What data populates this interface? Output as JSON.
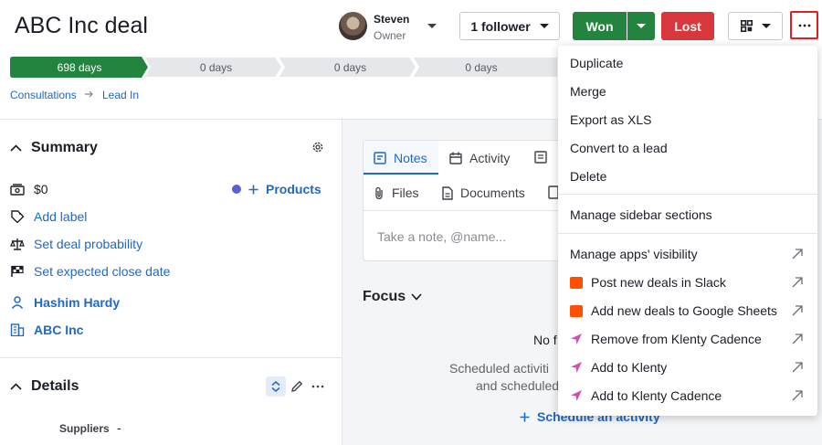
{
  "deal": {
    "title": "ABC Inc deal"
  },
  "owner": {
    "name": "Steven",
    "role": "Owner"
  },
  "header": {
    "follower_label": "1 follower",
    "won_label": "Won",
    "lost_label": "Lost"
  },
  "pipeline": {
    "stages": [
      {
        "label": "698 days",
        "active": true
      },
      {
        "label": "0 days",
        "active": false
      },
      {
        "label": "0 days",
        "active": false
      },
      {
        "label": "0 days",
        "active": false
      }
    ],
    "breadcrumb": [
      "Consultations",
      "Lead In"
    ]
  },
  "summary": {
    "title": "Summary",
    "value": "$0",
    "products_label": "Products",
    "rows": [
      "Add label",
      "Set deal probability",
      "Set expected close date"
    ],
    "person": "Hashim Hardy",
    "organization": "ABC Inc"
  },
  "details": {
    "title": "Details",
    "field_label": "Suppliers",
    "field_value": "-"
  },
  "tabs": [
    "Notes",
    "Activity",
    "Files",
    "Documents"
  ],
  "note": {
    "placeholder": "Take a note, @name..."
  },
  "focus": {
    "title": "Focus",
    "empty_text": "No f",
    "scheduled_line1": "Scheduled activiti",
    "scheduled_line2": "and scheduled",
    "schedule_link": "Schedule an activity"
  },
  "menu": {
    "group1": [
      "Duplicate",
      "Merge",
      "Export as XLS",
      "Convert to a lead",
      "Delete"
    ],
    "group2": [
      "Manage sidebar sections"
    ],
    "group3": [
      {
        "label": "Manage apps' visibility",
        "icon": "none"
      },
      {
        "label": "Post new deals in Slack",
        "icon": "zapier-icon"
      },
      {
        "label": "Add new deals to Google Sheets",
        "icon": "zapier-icon"
      },
      {
        "label": "Remove from Klenty Cadence",
        "icon": "klenty-icon"
      },
      {
        "label": "Add to Klenty",
        "icon": "klenty-icon"
      },
      {
        "label": "Add to Klenty Cadence",
        "icon": "klenty-icon"
      }
    ]
  },
  "colors": {
    "won": "#23843f",
    "lost": "#d8383b",
    "link": "#2069c4",
    "highlight": "#e02020",
    "zapier": "#ff4f00",
    "klenty": "#d64fb0"
  }
}
